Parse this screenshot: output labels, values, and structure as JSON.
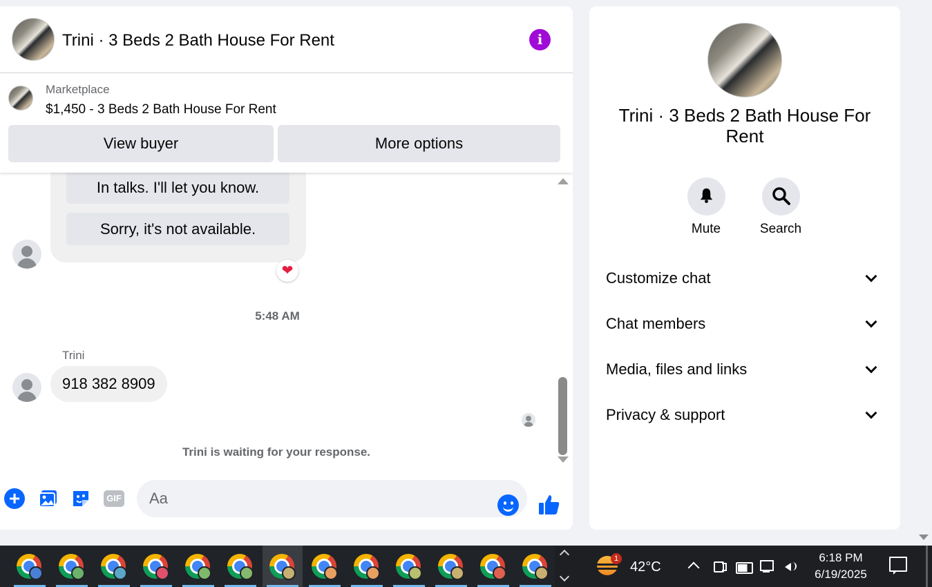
{
  "chat": {
    "title": "Trini · 3 Beds 2 Bath House For Rent",
    "marketplace_label": "Marketplace",
    "listing": "$1,450 - 3 Beds 2 Bath House For Rent",
    "view_buyer": "View buyer",
    "more_options": "More options",
    "accent_color": "#a10bd8"
  },
  "messages": {
    "quick_replies": [
      "In talks. I'll let you know.",
      "Sorry, it's not available."
    ],
    "reaction": "❤",
    "timestamp": "5:48 AM",
    "sender": "Trini",
    "message_text": "918 382 8909",
    "waiting_notice": "Trini is waiting for your response."
  },
  "composer": {
    "placeholder": "Aa",
    "gif_label": "GIF",
    "plus_label": "+"
  },
  "info_panel": {
    "title": "Trini · 3 Beds 2 Bath House For Rent",
    "actions": [
      {
        "label": "Mute",
        "icon": "bell-icon"
      },
      {
        "label": "Search",
        "icon": "search-icon"
      }
    ],
    "sections": [
      "Customize chat",
      "Chat members",
      "Media, files and links",
      "Privacy & support"
    ]
  },
  "taskbar": {
    "apps": [
      {
        "icon": "chrome-icon",
        "profile_color": "#4a7fd6",
        "active": false
      },
      {
        "icon": "chrome-icon",
        "profile_color": "#6bb36b",
        "active": false
      },
      {
        "icon": "chrome-icon",
        "profile_color": "#5aa7c8",
        "active": false
      },
      {
        "icon": "chrome-icon",
        "profile_color": "#e0506c",
        "active": false
      },
      {
        "icon": "chrome-icon",
        "profile_color": "#7dbb6a",
        "active": false
      },
      {
        "icon": "chrome-icon",
        "profile_color": "#86b86e",
        "active": false
      },
      {
        "icon": "chrome-icon",
        "profile_color": "#c8b070",
        "active": true
      },
      {
        "icon": "chrome-icon",
        "profile_color": "#e8a060",
        "active": false
      },
      {
        "icon": "chrome-icon",
        "profile_color": "#e8a060",
        "active": false
      },
      {
        "icon": "chrome-icon",
        "profile_color": "#b8c070",
        "active": false
      },
      {
        "icon": "chrome-icon",
        "profile_color": "#c8b070",
        "active": false
      },
      {
        "icon": "chrome-icon",
        "profile_color": "#e06050",
        "active": false
      },
      {
        "icon": "chrome-icon",
        "profile_color": "#c8b070",
        "active": false
      }
    ],
    "weather_badge": "1",
    "temperature": "42°C",
    "time": "6:18 PM",
    "date": "6/19/2025"
  }
}
